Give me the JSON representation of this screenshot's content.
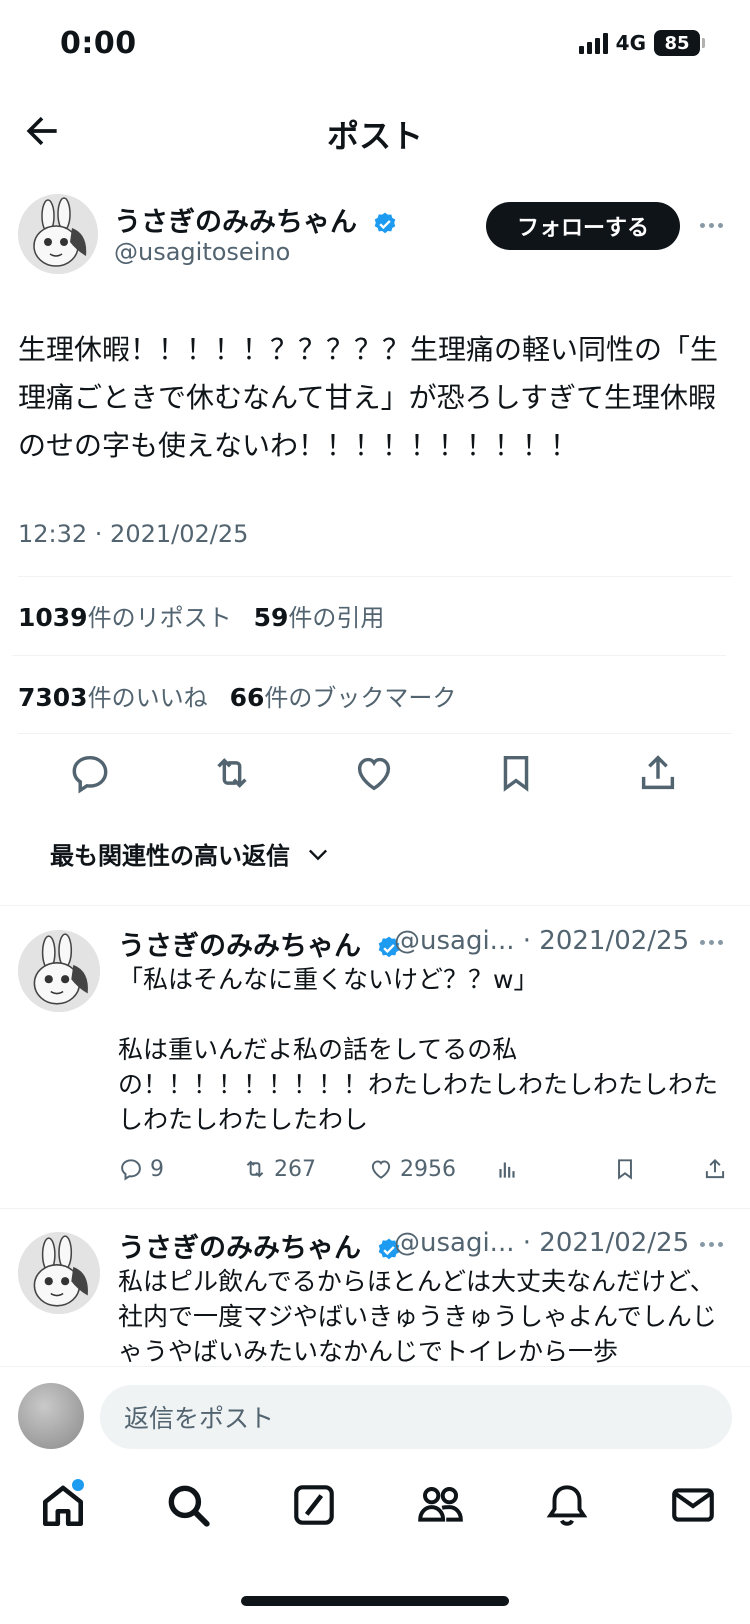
{
  "status_bar": {
    "time": "0:00",
    "network": "4G",
    "battery": "85"
  },
  "header": {
    "title": "ポスト"
  },
  "post": {
    "author_name": "うさぎのみみちゃん",
    "author_handle": "@usagitoseino",
    "follow_label": "フォローする",
    "text": "生理休暇！！！！！？？？？？生理痛の軽い同性の「生理痛ごときで休むなんて甘え」が恐ろしすぎて生理休暇のせの字も使えないわ！！！！！！！！！！",
    "timestamp": "12:32 · 2021/02/25",
    "reposts_count": "1039",
    "reposts_label": "件のリポスト",
    "quotes_count": "59",
    "quotes_label": "件の引用",
    "likes_count": "7303",
    "likes_label": "件のいいね",
    "bookmarks_count": "66",
    "bookmarks_label": "件のブックマーク"
  },
  "replies_sort": {
    "label": "最も関連性の高い返信"
  },
  "replies": [
    {
      "author_name": "うさぎのみみちゃん",
      "meta": "@usagi... · 2021/02/25",
      "text": "「私はそんなに重くないけど？？w」\n\n私は重いんだよ私の話をしてるの私の！！！！！！！！！わたしわたしわたしわたしわたしわたしわたしたわし",
      "reply_count": "9",
      "repost_count": "267",
      "like_count": "2956"
    },
    {
      "author_name": "うさぎのみみちゃん",
      "meta": "@usagi... · 2021/02/25",
      "text": "私はピル飲んでるからほとんどは大丈夫なんだけど、社内で一度マジやばいきゅうきゅうしゃよんでしんじゃうやばいみたいなかんじでトイレから一歩"
    }
  ],
  "composer": {
    "placeholder": "返信をポスト"
  },
  "tabbar": {
    "icons": [
      "home-icon",
      "search-icon",
      "grok-icon",
      "communities-icon",
      "notifications-icon",
      "messages-icon"
    ]
  },
  "colors": {
    "accent": "#1d9bf0",
    "text": "#0f1419",
    "secondary": "#536471",
    "divider": "#eff3f4"
  }
}
